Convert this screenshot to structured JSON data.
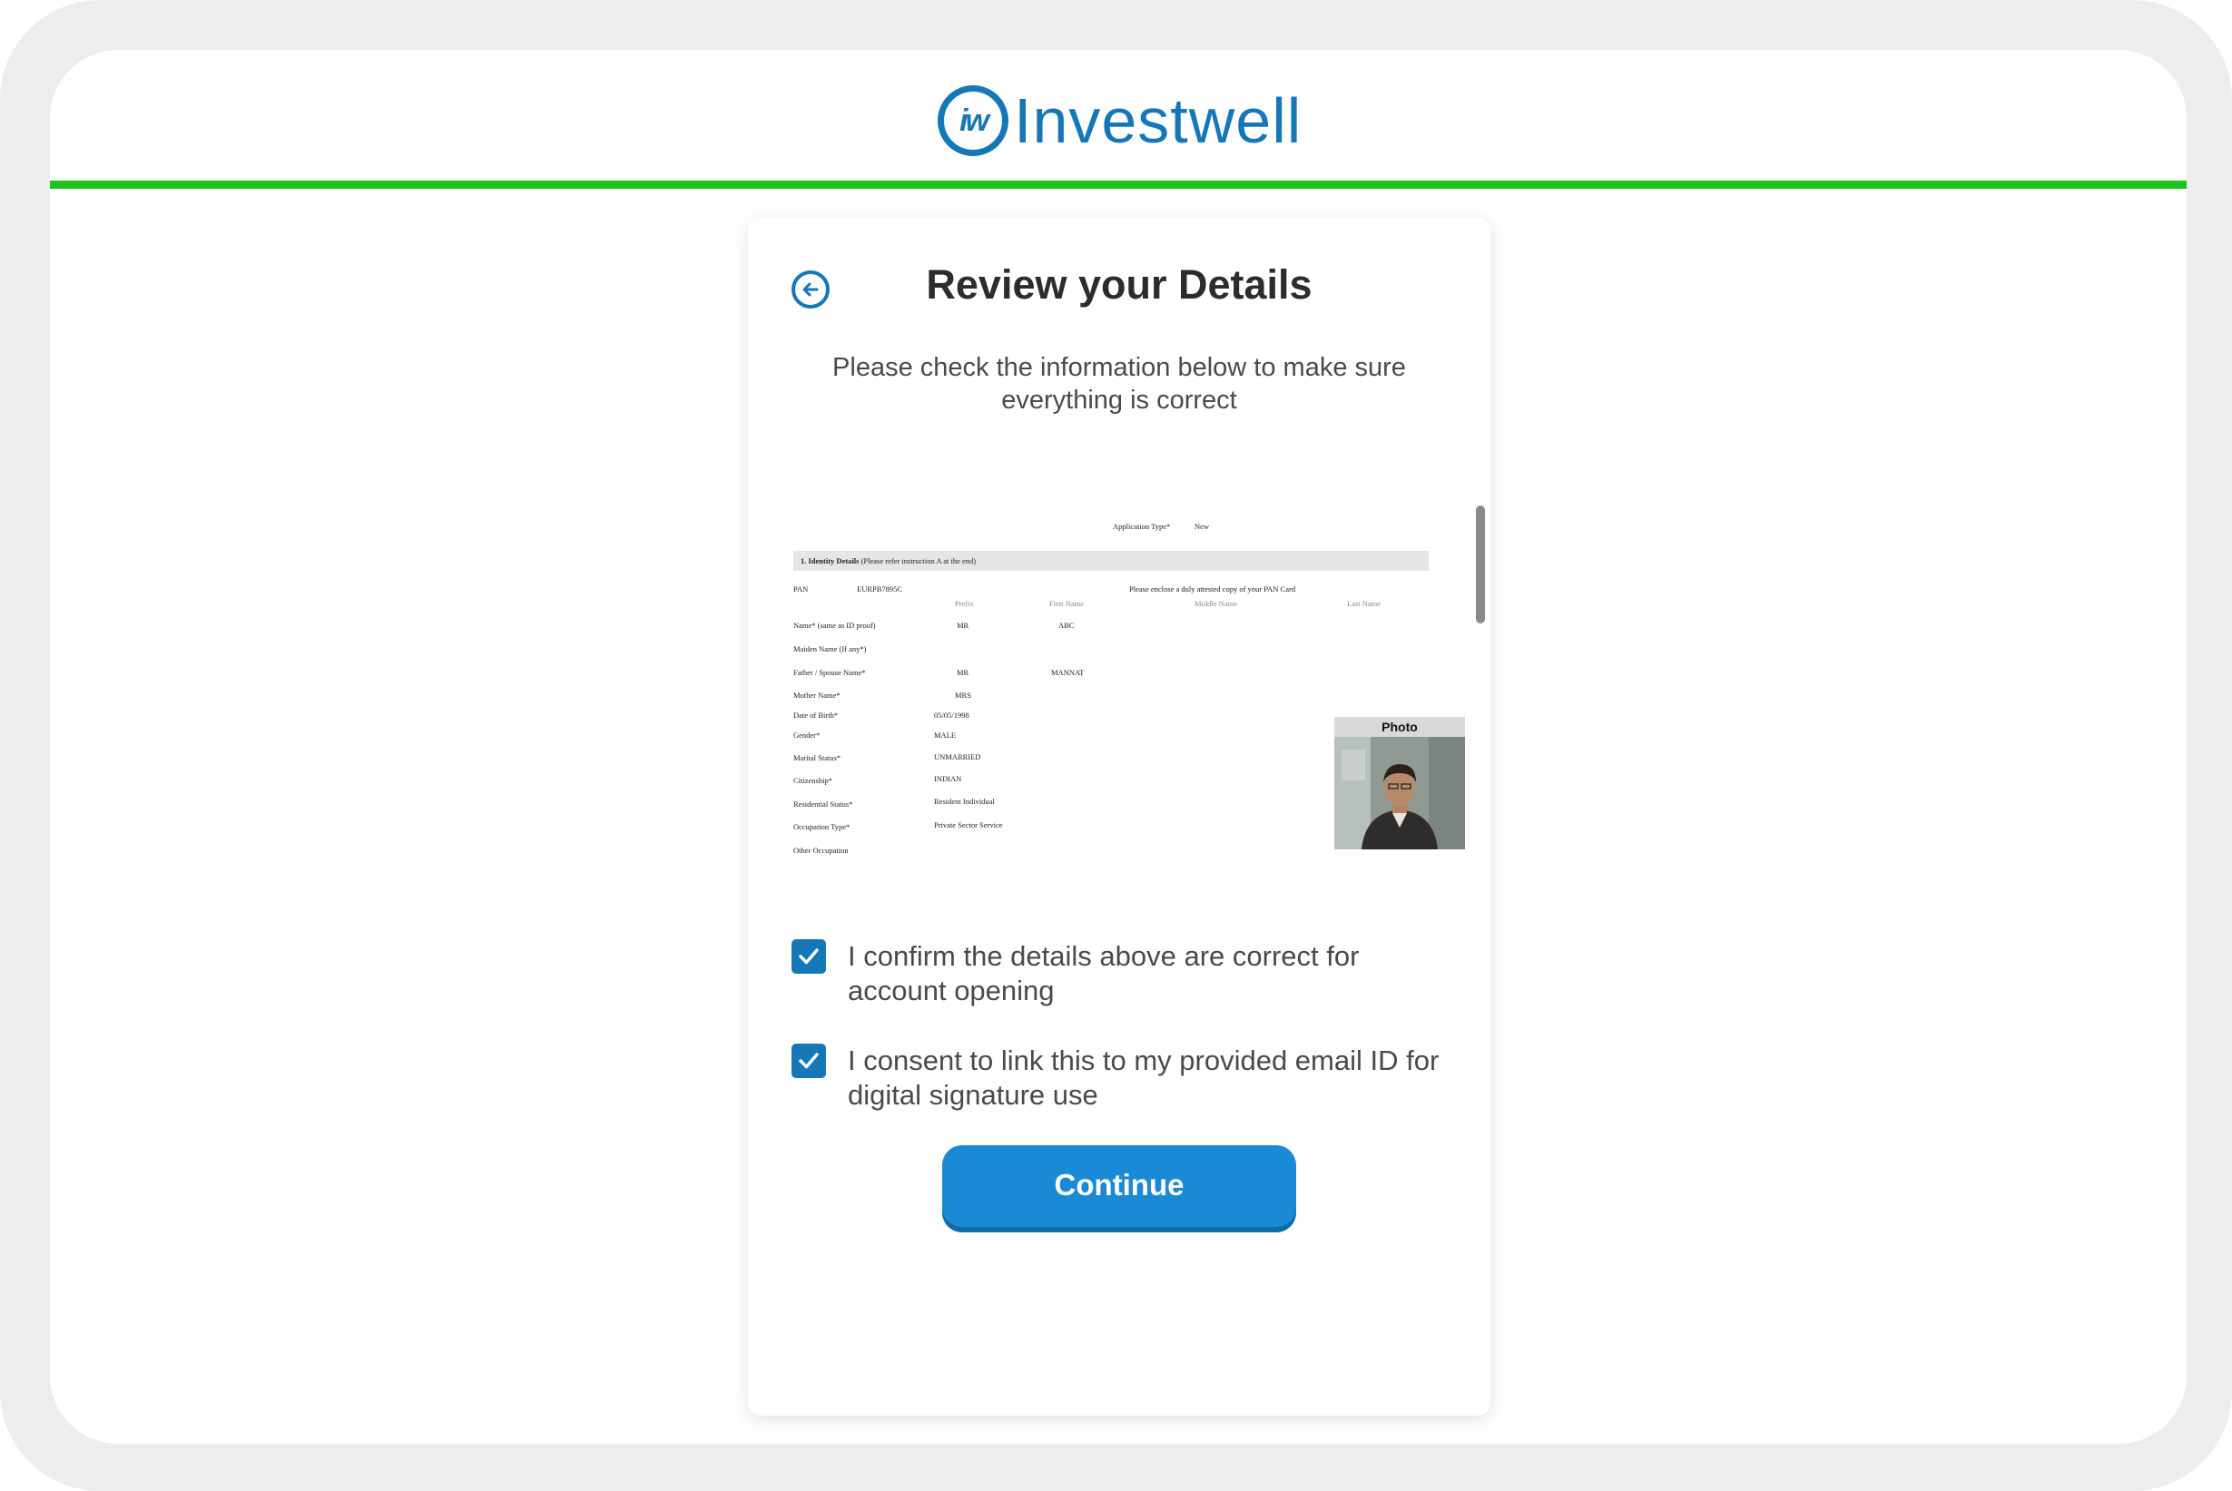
{
  "header": {
    "logo_mark": "iw",
    "logo_text": "Investwell",
    "brand_color": "#1677b7",
    "progress_color": "#1ec21e"
  },
  "card": {
    "back_icon": "arrow-left-circle-icon",
    "title": "Review your Details",
    "subtitle": "Please check the information below to make sure everything is correct"
  },
  "document": {
    "application_type_label": "Application Type*",
    "application_type_value": "New",
    "section_title": "1. Identity Details",
    "section_note": "(Please refer instruction A at the end)",
    "pan_label": "PAN",
    "pan_value": "EURPB7895C",
    "pan_note": "Please enclose a duly attested copy of your PAN Card",
    "name_columns": [
      "Prefix",
      "First Name",
      "Middle Name",
      "Last Name"
    ],
    "fields": [
      {
        "label": "Name* (same as ID proof)",
        "prefix": "MR",
        "value": "ABC"
      },
      {
        "label": "Maiden Name (If any*)",
        "prefix": "",
        "value": ""
      },
      {
        "label": "Father / Spouse Name*",
        "prefix": "MR",
        "value": "MANNAT"
      },
      {
        "label": "Mother Name*",
        "prefix": "MRS",
        "value": ""
      },
      {
        "label": "Date of Birth*",
        "value": "05/05/1998"
      },
      {
        "label": "Gender*",
        "value": "MALE"
      },
      {
        "label": "Marital Status*",
        "value": "UNMARRIED"
      },
      {
        "label": "Citizenship*",
        "value": "INDIAN"
      },
      {
        "label": "Residential Status*",
        "value": "Resident Individual"
      },
      {
        "label": "Occupation Type*",
        "value": "Private Sector Service"
      },
      {
        "label": "Other Occupation",
        "value": ""
      }
    ],
    "photo_label": "Photo"
  },
  "consents": [
    {
      "checked": true,
      "label": "I confirm the details above are correct for account opening"
    },
    {
      "checked": true,
      "label": "I consent to link this to my provided email ID for digital signature use"
    }
  ],
  "continue_label": "Continue"
}
